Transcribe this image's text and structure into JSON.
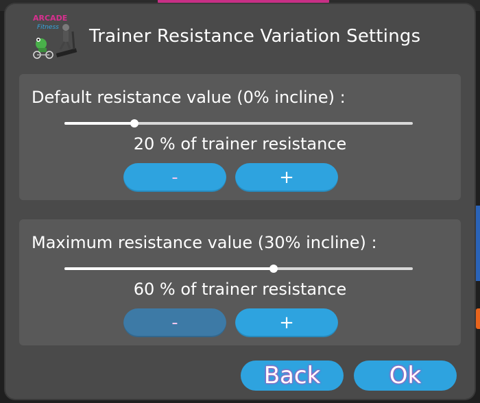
{
  "dialog": {
    "title": "Trainer Resistance Variation Settings",
    "logo": {
      "brand": "ARCADE",
      "subtitle": "Fitness"
    }
  },
  "settings": [
    {
      "label": "Default resistance value (0% incline) :",
      "value_text": "20 % of trainer resistance",
      "slider_fraction": 0.2,
      "minus_label": "-",
      "plus_label": "+",
      "minus_enabled": true
    },
    {
      "label": "Maximum resistance value (30% incline) :",
      "value_text": "60 % of trainer resistance",
      "slider_fraction": 0.6,
      "minus_label": "-",
      "plus_label": "+",
      "minus_enabled": false
    }
  ],
  "footer": {
    "back_label": "Back",
    "ok_label": "Ok"
  },
  "colors": {
    "dialog_bg": "#4a4a4a",
    "panel_bg": "#595959",
    "button": "#2ea3df",
    "button_disabled": "#3d7aa6",
    "text_glow": "#d445b0"
  }
}
